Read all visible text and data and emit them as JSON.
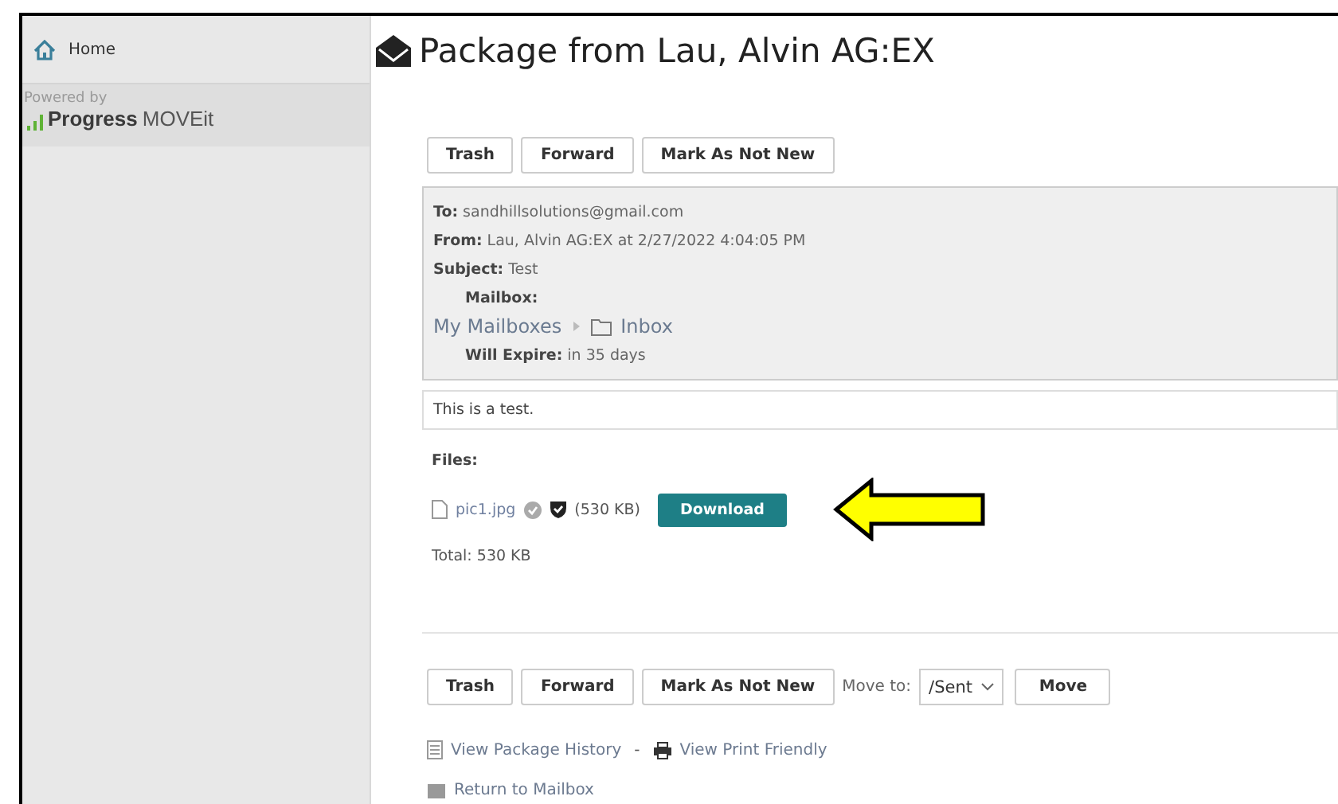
{
  "sidebar": {
    "home": {
      "label": "Home"
    },
    "powered_by": "Powered by",
    "brand": {
      "name": "Progress",
      "product": "MOVEit"
    }
  },
  "title": "Package from Lau, Alvin AG:EX",
  "top_actions": [
    "Trash",
    "Forward",
    "Mark As Not New"
  ],
  "details": {
    "to_label": "To:",
    "to": "sandhillsolutions@gmail.com",
    "from_label": "From:",
    "from": "Lau, Alvin AG:EX at 2/27/2022 4:04:05 PM",
    "subject_label": "Subject:",
    "subject": "Test",
    "mailbox_label": "Mailbox:",
    "mailbox_path": [
      "My Mailboxes",
      "Inbox"
    ],
    "expire_label": "Will Expire:",
    "expire": "in 35 days"
  },
  "message": "This is a test.",
  "files": {
    "label": "Files:",
    "items": [
      {
        "name": "pic1.jpg",
        "size": "(530 KB)",
        "action": "Download"
      }
    ],
    "total": "Total: 530 KB"
  },
  "bottom_actions": [
    "Trash",
    "Forward",
    "Mark As Not New"
  ],
  "move": {
    "label": "Move to:",
    "value": "/Sent",
    "button": "Move"
  },
  "links": [
    {
      "kind": "history",
      "label": "View Package History"
    },
    {
      "kind": "print",
      "label": "View Print Friendly"
    }
  ],
  "link_separator": "-",
  "return_link": {
    "label": "Return to Mailbox"
  }
}
